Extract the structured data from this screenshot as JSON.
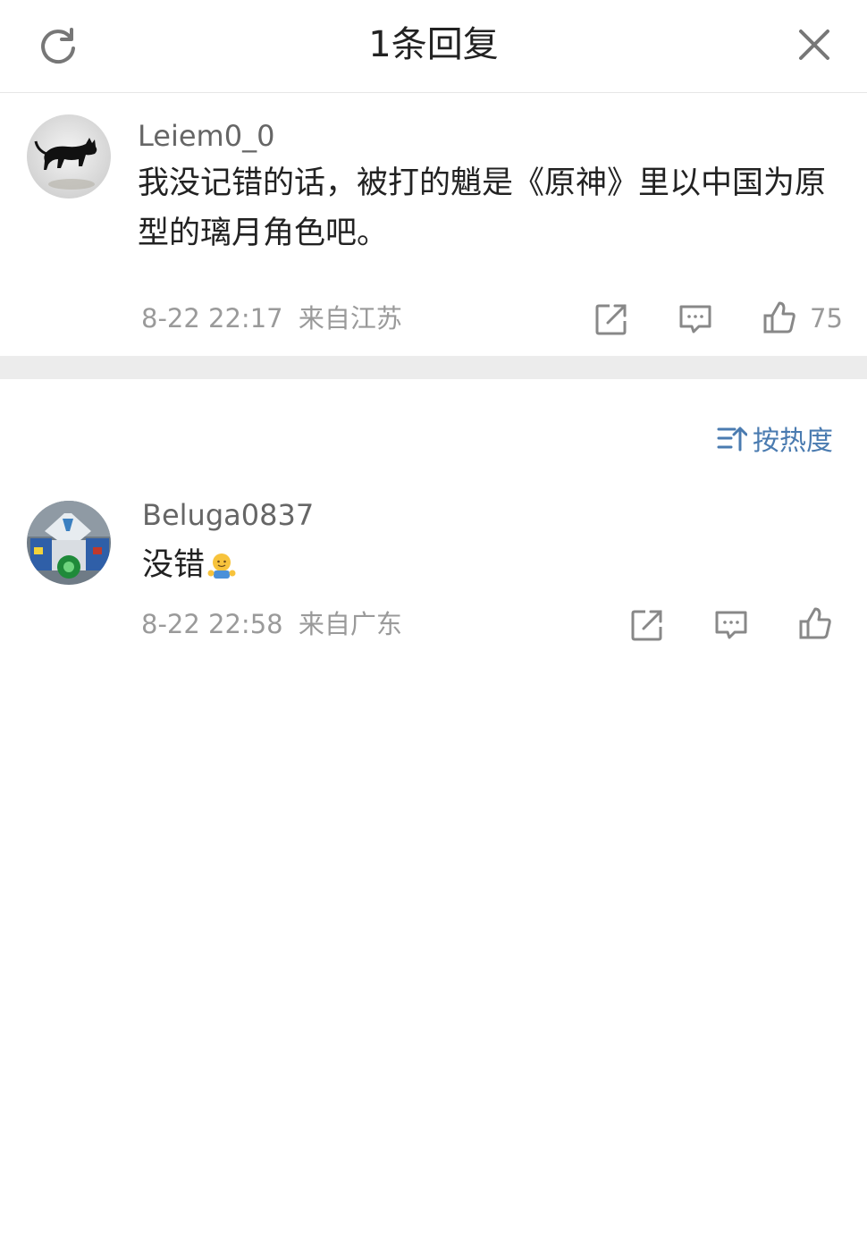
{
  "header": {
    "title": "1条回复",
    "refresh_icon": "refresh-icon",
    "close_icon": "close-icon"
  },
  "root_comment": {
    "username": "Leiem0_0",
    "text": "我没记错的话，被打的魈是《原神》里以中国为原型的璃月角色吧。",
    "date": "8-22 22:17",
    "location": "来自江苏",
    "like_count": "75",
    "icons": [
      "share-icon",
      "comment-icon",
      "like-icon"
    ]
  },
  "sort": {
    "label": "按热度",
    "icon": "sort-icon"
  },
  "replies": [
    {
      "username": "Beluga0837",
      "text": "没错",
      "emoji": "hug-emoji",
      "date": "8-22 22:58",
      "location": "来自广东",
      "icons": [
        "share-icon",
        "comment-icon",
        "like-icon"
      ]
    }
  ],
  "colors": {
    "accent": "#4a7bb0",
    "meta_text": "#9a9a9a",
    "divider": "#ececec"
  }
}
